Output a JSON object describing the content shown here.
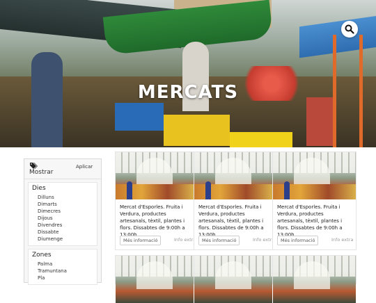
{
  "hero": {
    "title": "MERCATS",
    "search_icon": "search-icon"
  },
  "sidebar": {
    "header": {
      "icon": "tag-icon",
      "label": "Mostrar",
      "apply_label": "Aplicar"
    },
    "groups": [
      {
        "title": "Dies",
        "items": [
          "Dilluns",
          "Dimarts",
          "Dimecres",
          "Dijous",
          "Divendres",
          "Dissabte",
          "Diumenge"
        ]
      },
      {
        "title": "Zones",
        "items": [
          "Palma",
          "Tramuntana",
          "Pla"
        ]
      }
    ]
  },
  "cards": [
    {
      "description": "Mercat d'Esporles. Fruita i Verdura, productes artesanals, tèxtil, plantes i flors. Dissabtes de 9:00h a 13:00h.",
      "more_label": "Més informació",
      "extra_label": "Info extra"
    },
    {
      "description": "Mercat d'Esporles. Fruita i Verdura, productes artesanals, tèxtil, plantes i flors. Dissabtes de 9:00h a 13:00h.",
      "more_label": "Més informació",
      "extra_label": "Info extra"
    },
    {
      "description": "Mercat d'Esporles. Fruita i Verdura, productes artesanals, tèxtil, plantes i flors. Dissabtes de 9:00h a 13:00h.",
      "more_label": "Més informació",
      "extra_label": "Info extra"
    }
  ],
  "colors": {
    "accent": "#e06a2a",
    "hero_text": "#ffffff"
  }
}
